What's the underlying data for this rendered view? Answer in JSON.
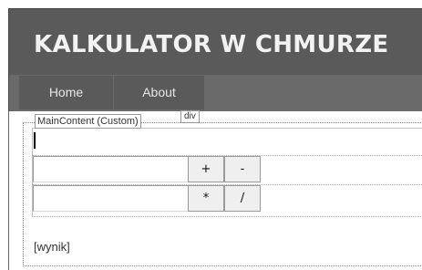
{
  "header": {
    "title": "KALKULATOR W CHMURZE"
  },
  "menu": {
    "items": [
      {
        "label": "Home"
      },
      {
        "label": "About"
      }
    ]
  },
  "designer": {
    "region_label": "MainContent (Custom)",
    "element_tag": "div"
  },
  "calculator": {
    "first_number": {
      "value": "",
      "placeholder": ""
    },
    "second_number": {
      "value": "",
      "placeholder": ""
    },
    "buttons": {
      "add": "+",
      "subtract": "-",
      "multiply": "*",
      "divide": "/"
    },
    "result": "[wynik]"
  }
}
